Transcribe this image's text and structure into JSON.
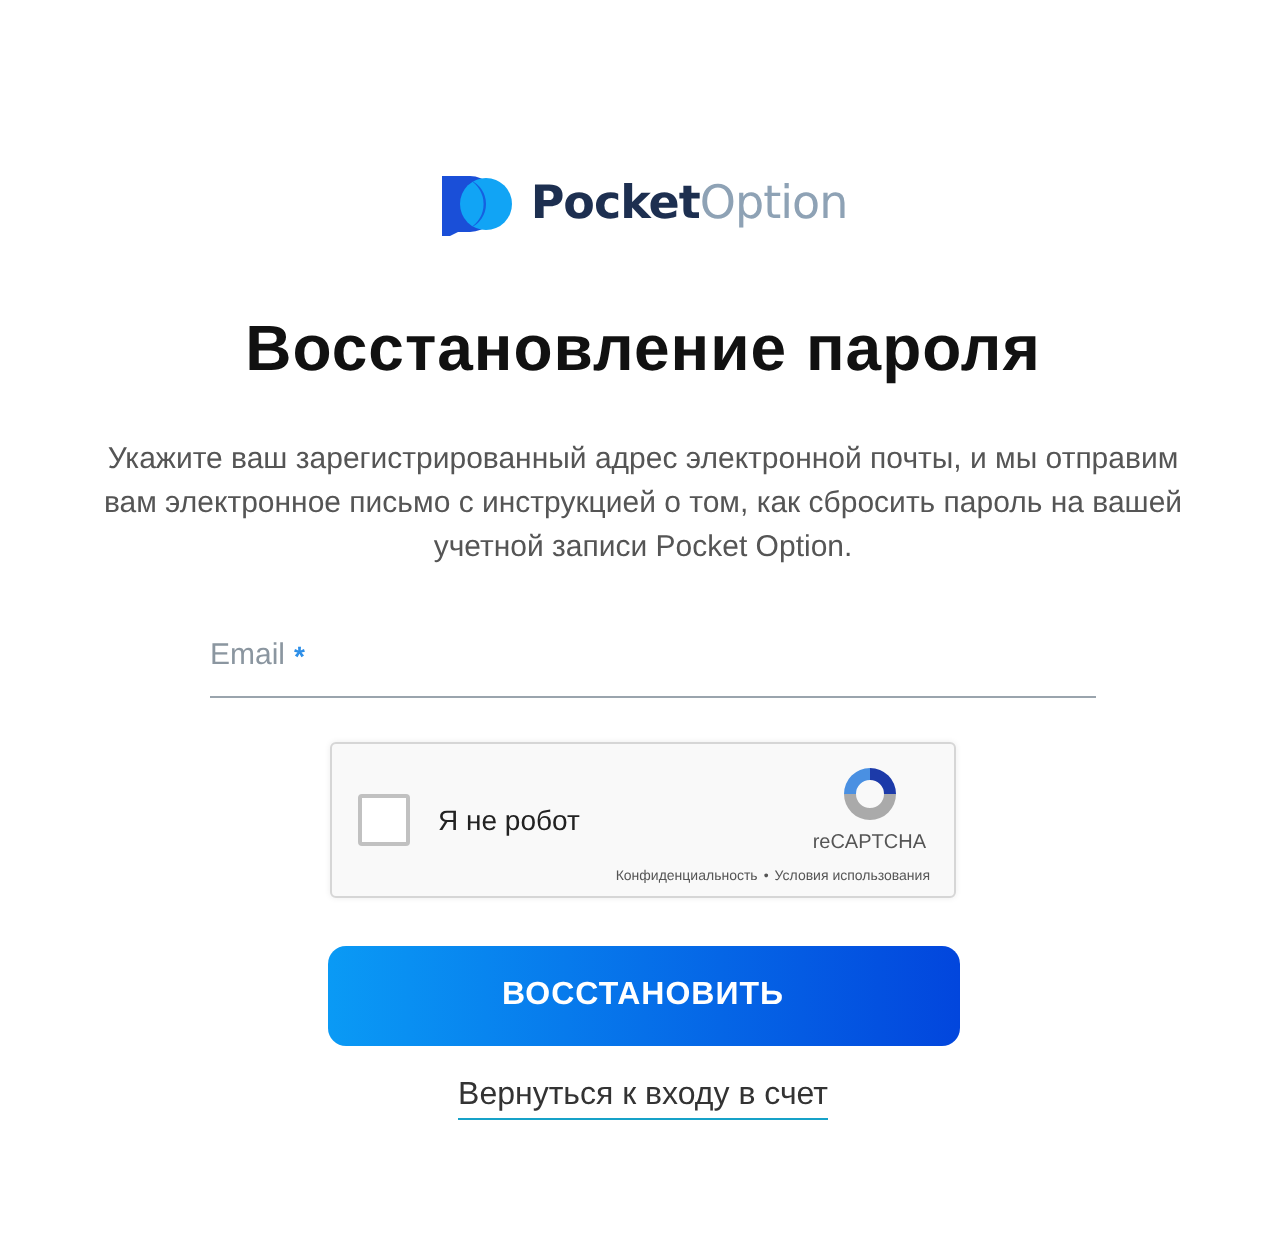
{
  "logo": {
    "primary": "Pocket",
    "secondary": "Option"
  },
  "title": "Восстановление пароля",
  "description": "Укажите ваш зарегистрированный адрес электронной почты, и мы отправим вам электронное письмо с инструкцией о том, как сбросить пароль на вашей учетной записи Pocket Option.",
  "email": {
    "placeholder": "Email",
    "required_mark": "*"
  },
  "captcha": {
    "label": "Я не робот",
    "checked": false,
    "brand": "reCAPTCHA",
    "privacy": "Конфиденциальность",
    "separator": "•",
    "terms": "Условия использования"
  },
  "submit": "ВОССТАНОВИТЬ",
  "back_link": "Вернуться к входу в счет"
}
